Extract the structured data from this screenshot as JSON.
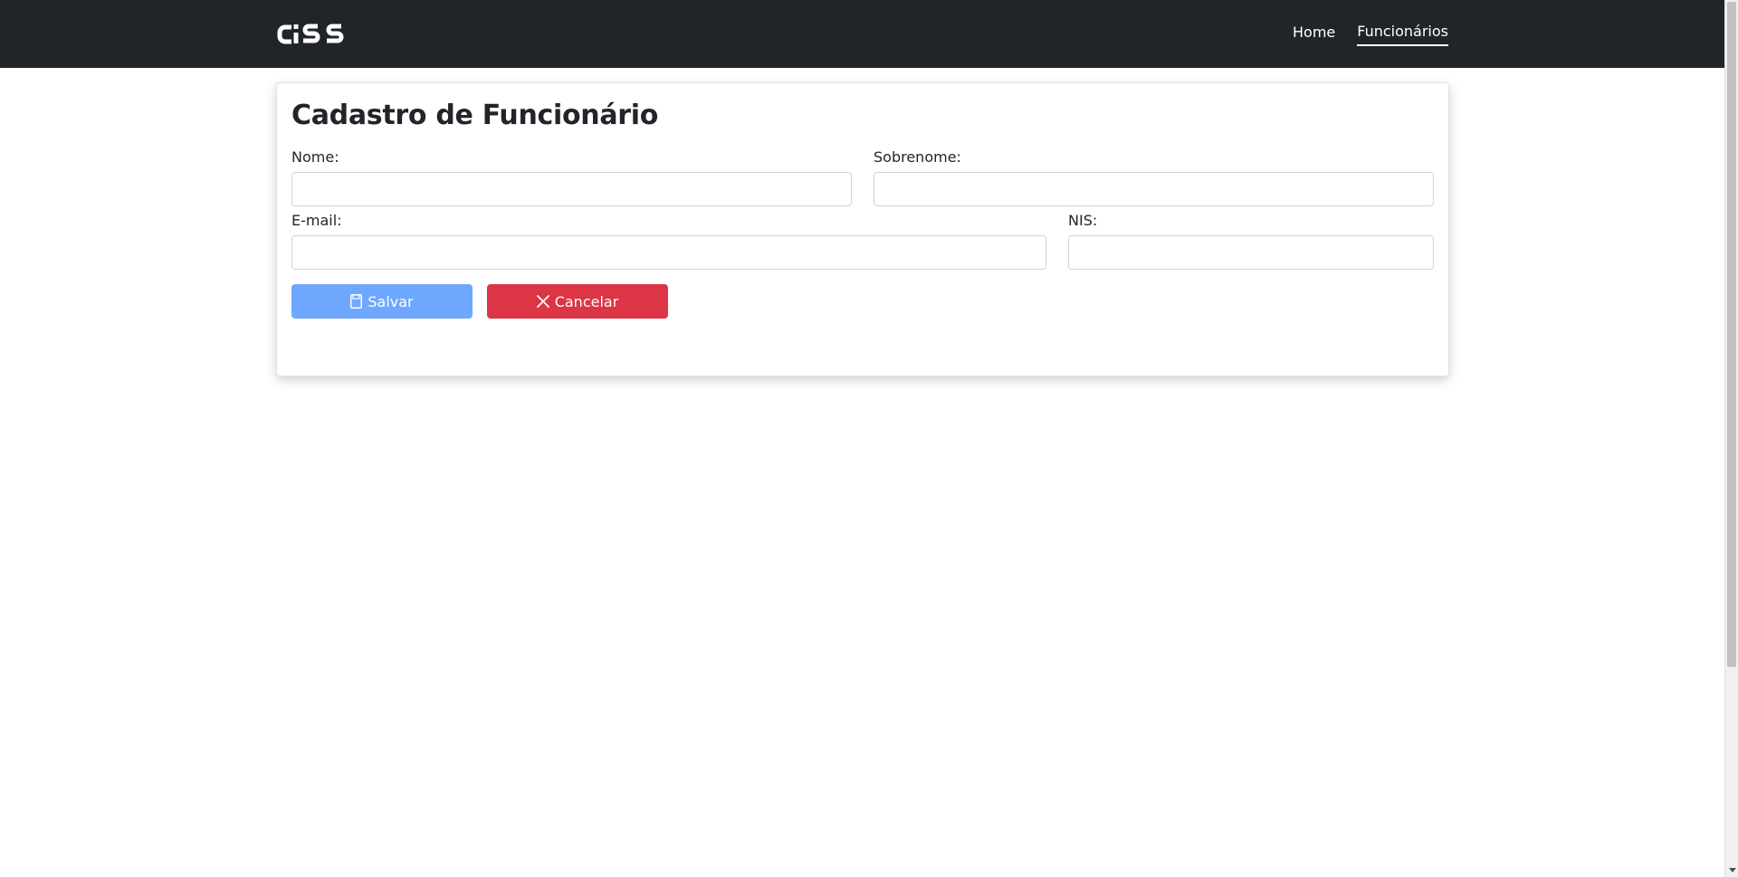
{
  "brand": {
    "logo_text": "CiSS"
  },
  "nav": {
    "items": [
      {
        "label": "Home",
        "active": false
      },
      {
        "label": "Funcionários",
        "active": true
      }
    ]
  },
  "form": {
    "title": "Cadastro de Funcionário",
    "fields": {
      "nome": {
        "label": "Nome:",
        "value": "",
        "placeholder": ""
      },
      "sobrenome": {
        "label": "Sobrenome:",
        "value": "",
        "placeholder": ""
      },
      "email": {
        "label": "E-mail:",
        "value": "",
        "placeholder": ""
      },
      "nis": {
        "label": "NIS:",
        "value": "",
        "placeholder": ""
      }
    },
    "buttons": {
      "save": {
        "label": "Salvar",
        "icon": "floppy-disk-icon",
        "color": "#6ea8fe"
      },
      "cancel": {
        "label": "Cancelar",
        "icon": "close-icon",
        "color": "#dc3545"
      }
    }
  },
  "colors": {
    "navbar": "#212529",
    "primary_light": "#6ea8fe",
    "danger": "#dc3545"
  }
}
